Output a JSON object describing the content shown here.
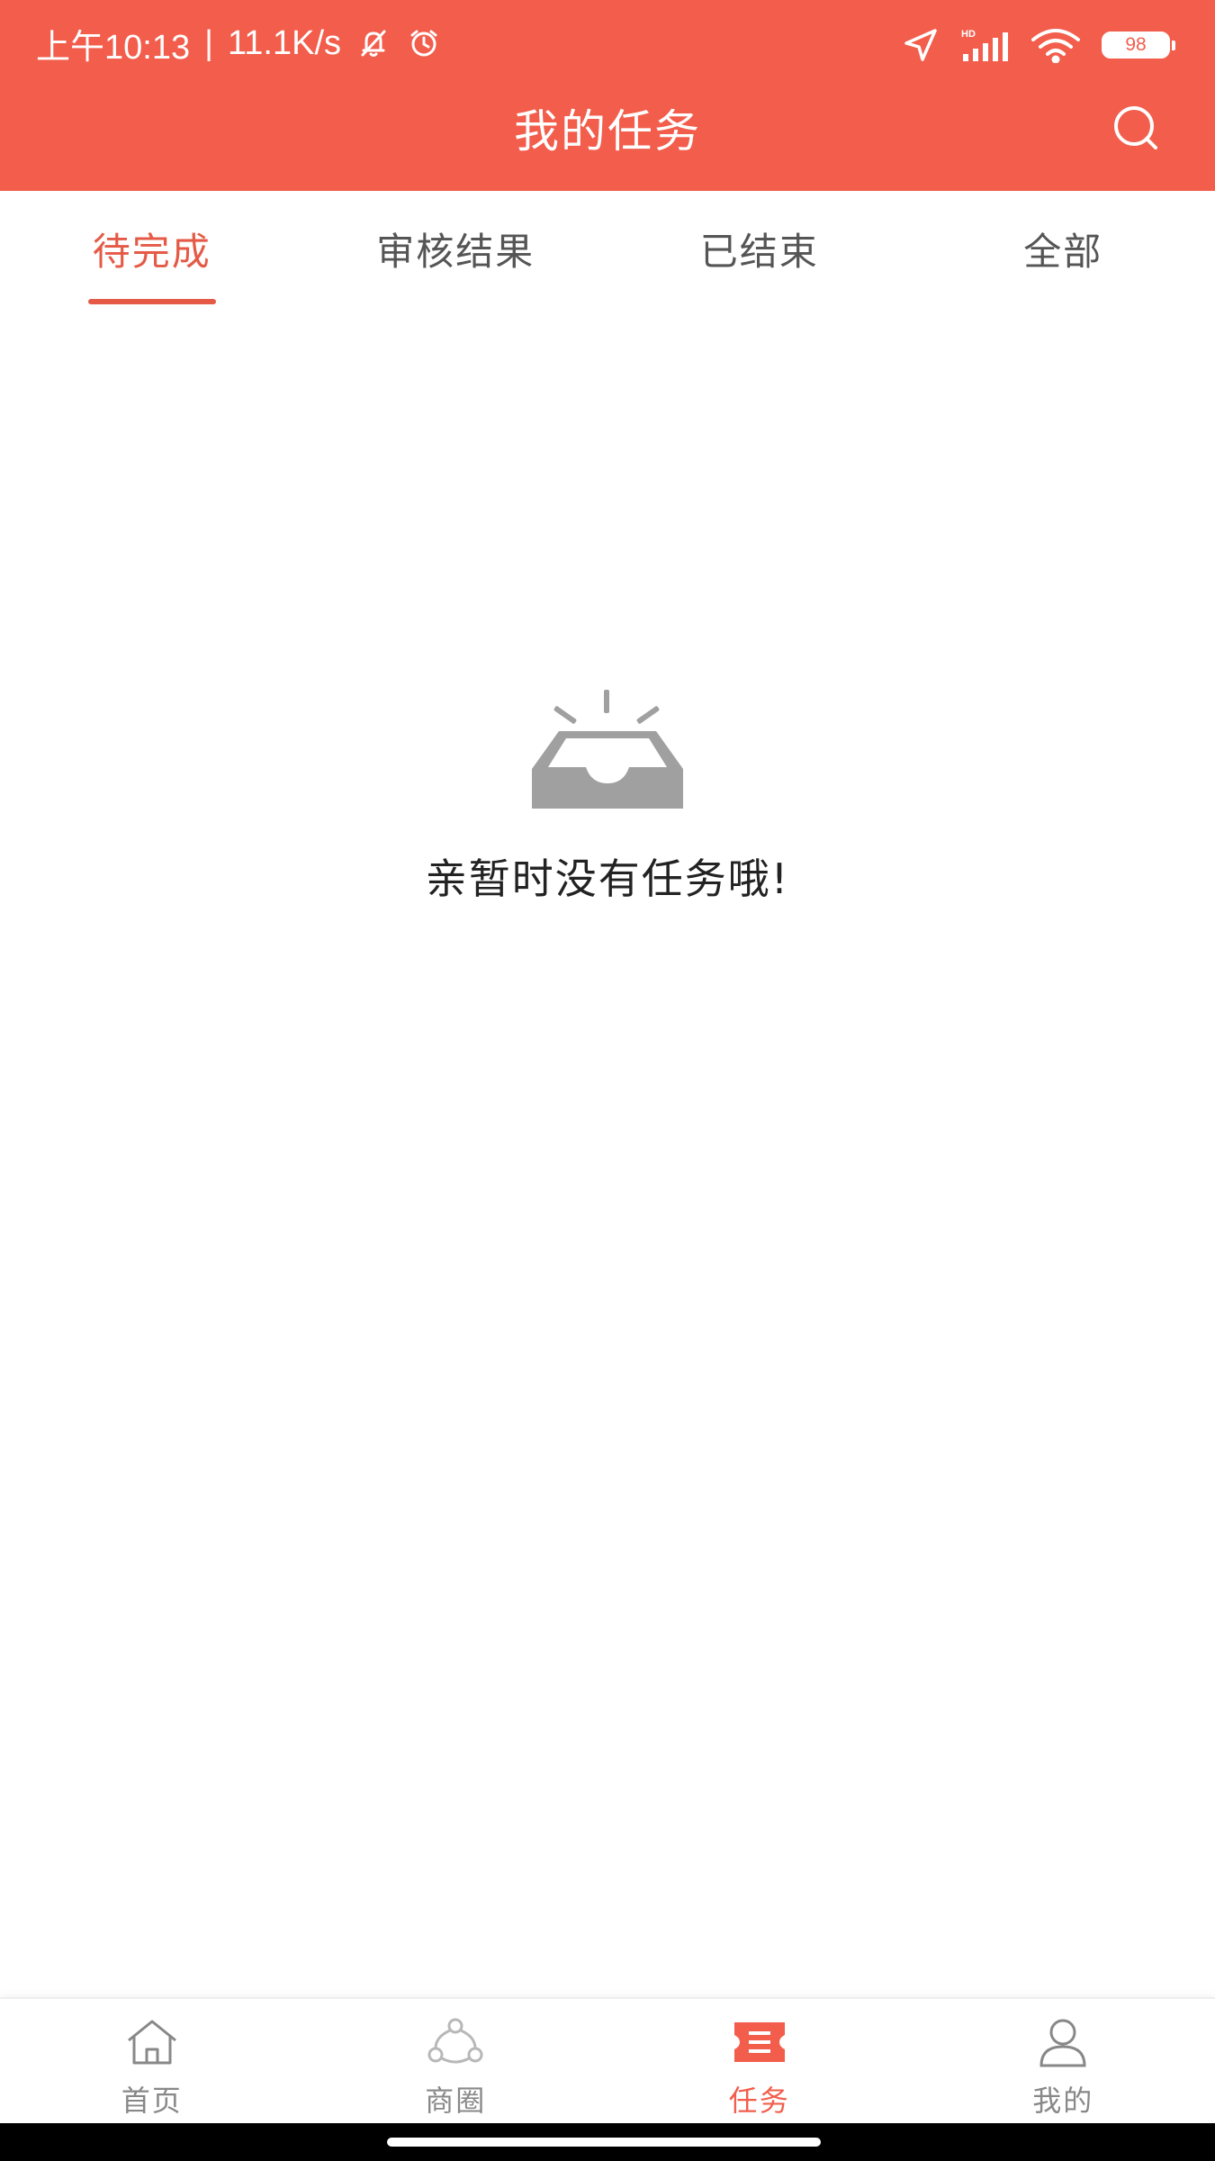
{
  "colors": {
    "brand": "#f25d4c",
    "active_tab": "#e55a47",
    "inactive_text": "#555555",
    "nav_inactive": "#888888",
    "empty_icon": "#a0a0a0"
  },
  "status_bar": {
    "time": "上午10:13",
    "separator": "|",
    "net_speed": "11.1K/s",
    "left_icons": [
      "bell-off-icon",
      "alarm-clock-icon"
    ],
    "right_icons": [
      "location-arrow-icon",
      "hd-signal-icon",
      "wifi-icon"
    ],
    "battery_level": "98"
  },
  "header": {
    "title": "我的任务",
    "search_icon": "search-icon"
  },
  "tabs": [
    {
      "label": "待完成",
      "active": true
    },
    {
      "label": "审核结果",
      "active": false
    },
    {
      "label": "已结束",
      "active": false
    },
    {
      "label": "全部",
      "active": false
    }
  ],
  "empty_state": {
    "icon": "empty-inbox-icon",
    "message": "亲暂时没有任务哦!"
  },
  "bottom_nav": [
    {
      "label": "首页",
      "icon": "home-icon",
      "active": false
    },
    {
      "label": "商圈",
      "icon": "network-icon",
      "active": false
    },
    {
      "label": "任务",
      "icon": "task-ticket-icon",
      "active": true
    },
    {
      "label": "我的",
      "icon": "profile-icon",
      "active": false
    }
  ]
}
